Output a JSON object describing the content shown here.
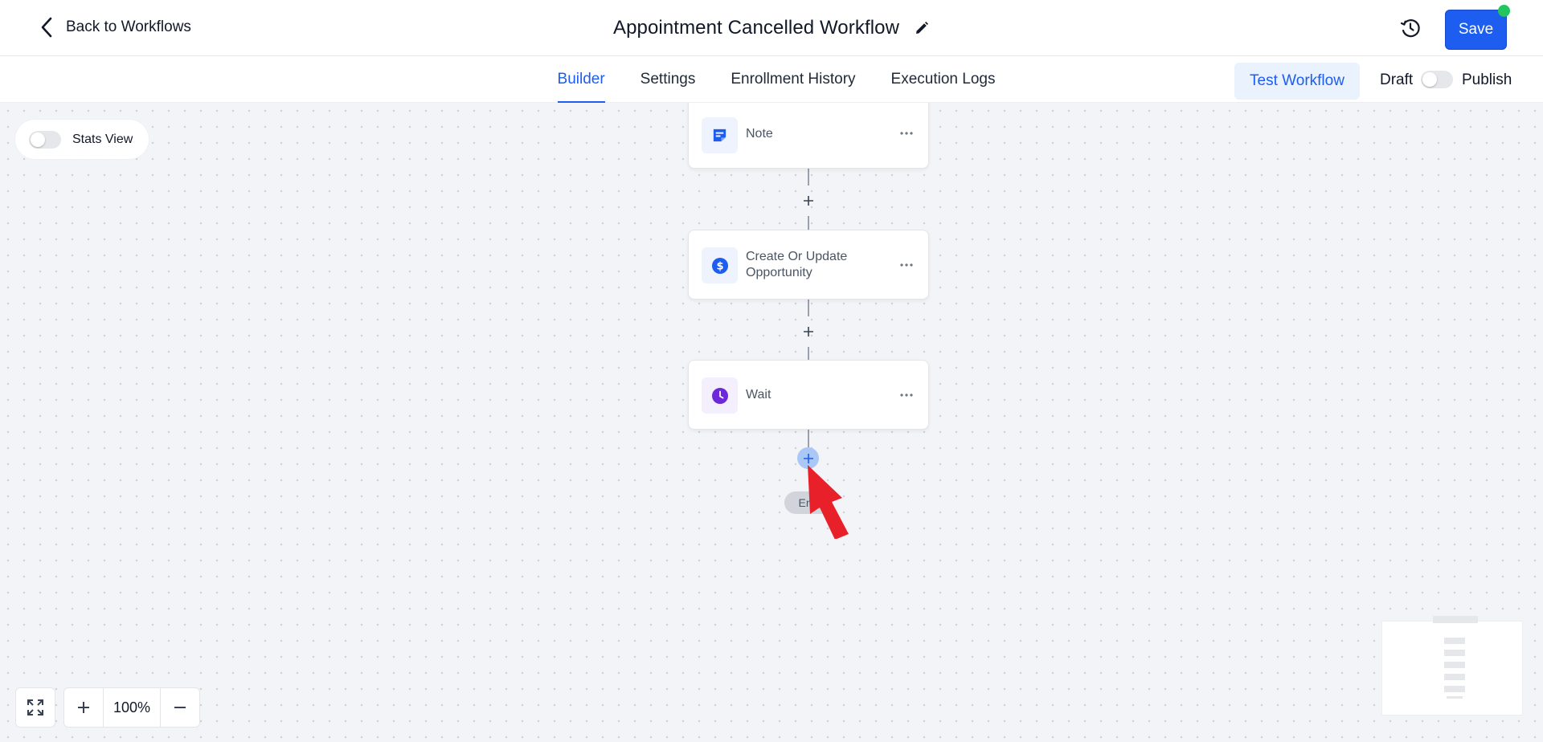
{
  "header": {
    "back_label": "Back to Workflows",
    "title": "Appointment Cancelled Workflow",
    "save_label": "Save"
  },
  "tabs": [
    {
      "label": "Builder",
      "active": true
    },
    {
      "label": "Settings",
      "active": false
    },
    {
      "label": "Enrollment History",
      "active": false
    },
    {
      "label": "Execution Logs",
      "active": false
    }
  ],
  "actions": {
    "test_label": "Test Workflow",
    "draft_label": "Draft",
    "publish_label": "Publish",
    "published": false
  },
  "canvas": {
    "stats_label": "Stats View",
    "stats_enabled": false,
    "nodes": [
      {
        "label": "Note",
        "icon": "note-icon",
        "icon_color": "#1d5df0"
      },
      {
        "label": "Create Or Update Opportunity",
        "icon": "dollar-icon",
        "icon_color": "#1d5df0"
      },
      {
        "label": "Wait",
        "icon": "clock-icon",
        "icon_color": "#6d28d9"
      }
    ],
    "end_label": "End"
  },
  "zoom": {
    "level": "100%"
  },
  "colors": {
    "accent": "#1d5df0",
    "status_online": "#22c55e",
    "pointer": "#e8202a"
  }
}
